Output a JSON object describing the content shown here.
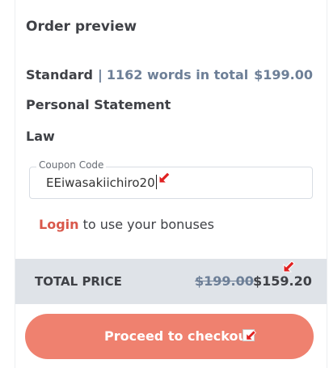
{
  "order": {
    "title": "Order preview",
    "service_level": "Standard",
    "separator": "|",
    "word_count": "1162 words in total",
    "base_price": "$199.00",
    "paper_type": "Personal Statement",
    "subject": "Law"
  },
  "coupon": {
    "label": "Coupon Code",
    "value": "EEiwasakiichiro20"
  },
  "login": {
    "link_label": "Login",
    "suffix": " to use your bonuses"
  },
  "total": {
    "label": "TOTAL PRICE",
    "old_price": "$199.00",
    "new_price": "$159.20"
  },
  "checkout": {
    "label": "Proceed to checkout"
  },
  "icons": {
    "annotation_arrow": "red-arrow-icon",
    "checkbox": "checkbox-icon"
  },
  "colors": {
    "accent": "#ef816f",
    "link": "#d9584b",
    "muted": "#6d7f97",
    "total_bar": "#dfe3e8",
    "annotation": "#e02020"
  }
}
